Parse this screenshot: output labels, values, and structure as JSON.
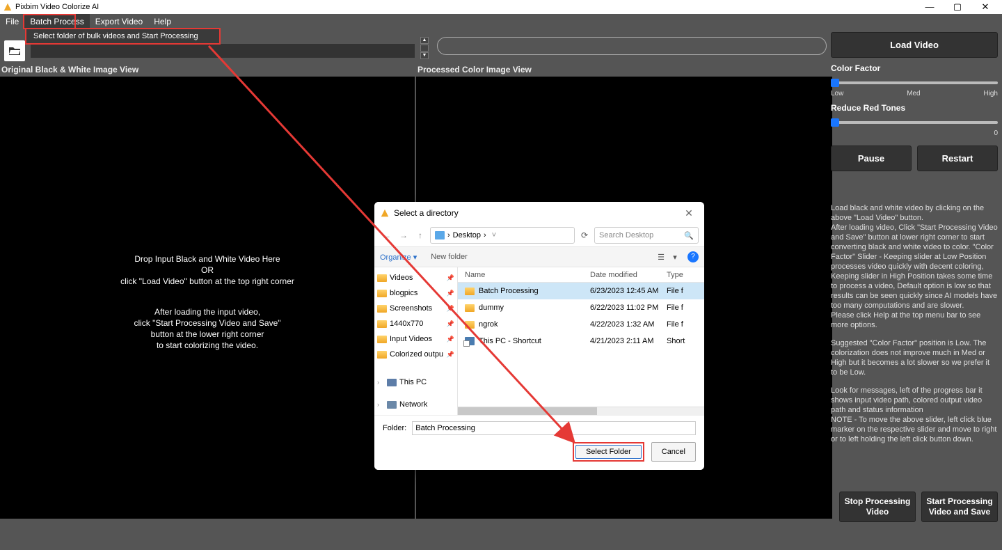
{
  "app": {
    "title": "Pixbim Video Colorize AI"
  },
  "menu": {
    "file": "File",
    "batch": "Batch Process",
    "export": "Export Video",
    "help": "Help",
    "batch_item": "Select folder of bulk videos and Start Processing"
  },
  "labels": {
    "orig": "Original Black & White Image View",
    "proc": "Processed Color Image View"
  },
  "drop": {
    "l1": "Drop Input Black and White Video Here",
    "l2": "OR",
    "l3": "click \"Load Video\" button at the top right corner",
    "l4": "After loading the input video,",
    "l5": "click \"Start Processing Video and Save\"",
    "l6": "button at the lower right corner",
    "l7": "to start colorizing the video."
  },
  "sidebar": {
    "load": "Load Video",
    "cf_label": "Color Factor",
    "cf_ticks": {
      "low": "Low",
      "med": "Med",
      "high": "High"
    },
    "rr_label": "Reduce Red Tones",
    "rr_max": "0",
    "pause": "Pause",
    "restart": "Restart",
    "stop": "Stop Processing Video",
    "start": "Start Processing Video and Save",
    "help1": "Load black and white video by clicking on the above \"Load Video\" button.\nAfter loading video, Click \"Start Processing Video and Save\" button at lower right corner to start converting black and white video to color. \"Color Factor\" Slider - Keeping slider at Low Position processes video quickly with decent coloring, Keeping slider in High Position takes some time to process a video, Default option is low so that results can be seen quickly since AI models have too many computations and are slower.\nPlease click Help at the top menu bar to see more options.",
    "help2": "Suggested \"Color Factor\" position is Low. The colorization does not improve much in Med or High but it becomes a lot slower so we prefer it to be Low.",
    "help3": "Look for messages, left of the progress bar it shows input video path, colored output video path and status information\nNOTE - To move the above slider, left click blue marker on the respective slider and move to right or to left holding the left click button down."
  },
  "dialog": {
    "title": "Select a directory",
    "breadcrumb": "Desktop",
    "search_ph": "Search Desktop",
    "organize": "Organize",
    "newfolder": "New folder",
    "cols": {
      "name": "Name",
      "date": "Date modified",
      "type": "Type"
    },
    "side": [
      "Videos",
      "blogpics",
      "Screenshots",
      "1440x770",
      "Input Videos",
      "Colorized outpu"
    ],
    "side2": [
      "This PC",
      "Network"
    ],
    "rows": [
      {
        "icon": "folder",
        "name": "Batch Processing",
        "date": "6/23/2023 12:45 AM",
        "type": "File f",
        "sel": true
      },
      {
        "icon": "folder",
        "name": "dummy",
        "date": "6/22/2023 11:02 PM",
        "type": "File f"
      },
      {
        "icon": "folder",
        "name": "ngrok",
        "date": "4/22/2023 1:32 AM",
        "type": "File f"
      },
      {
        "icon": "shortcut",
        "name": "This PC - Shortcut",
        "date": "4/21/2023 2:11 AM",
        "type": "Short"
      }
    ],
    "folder_label": "Folder:",
    "folder_value": "Batch Processing",
    "select": "Select Folder",
    "cancel": "Cancel"
  }
}
